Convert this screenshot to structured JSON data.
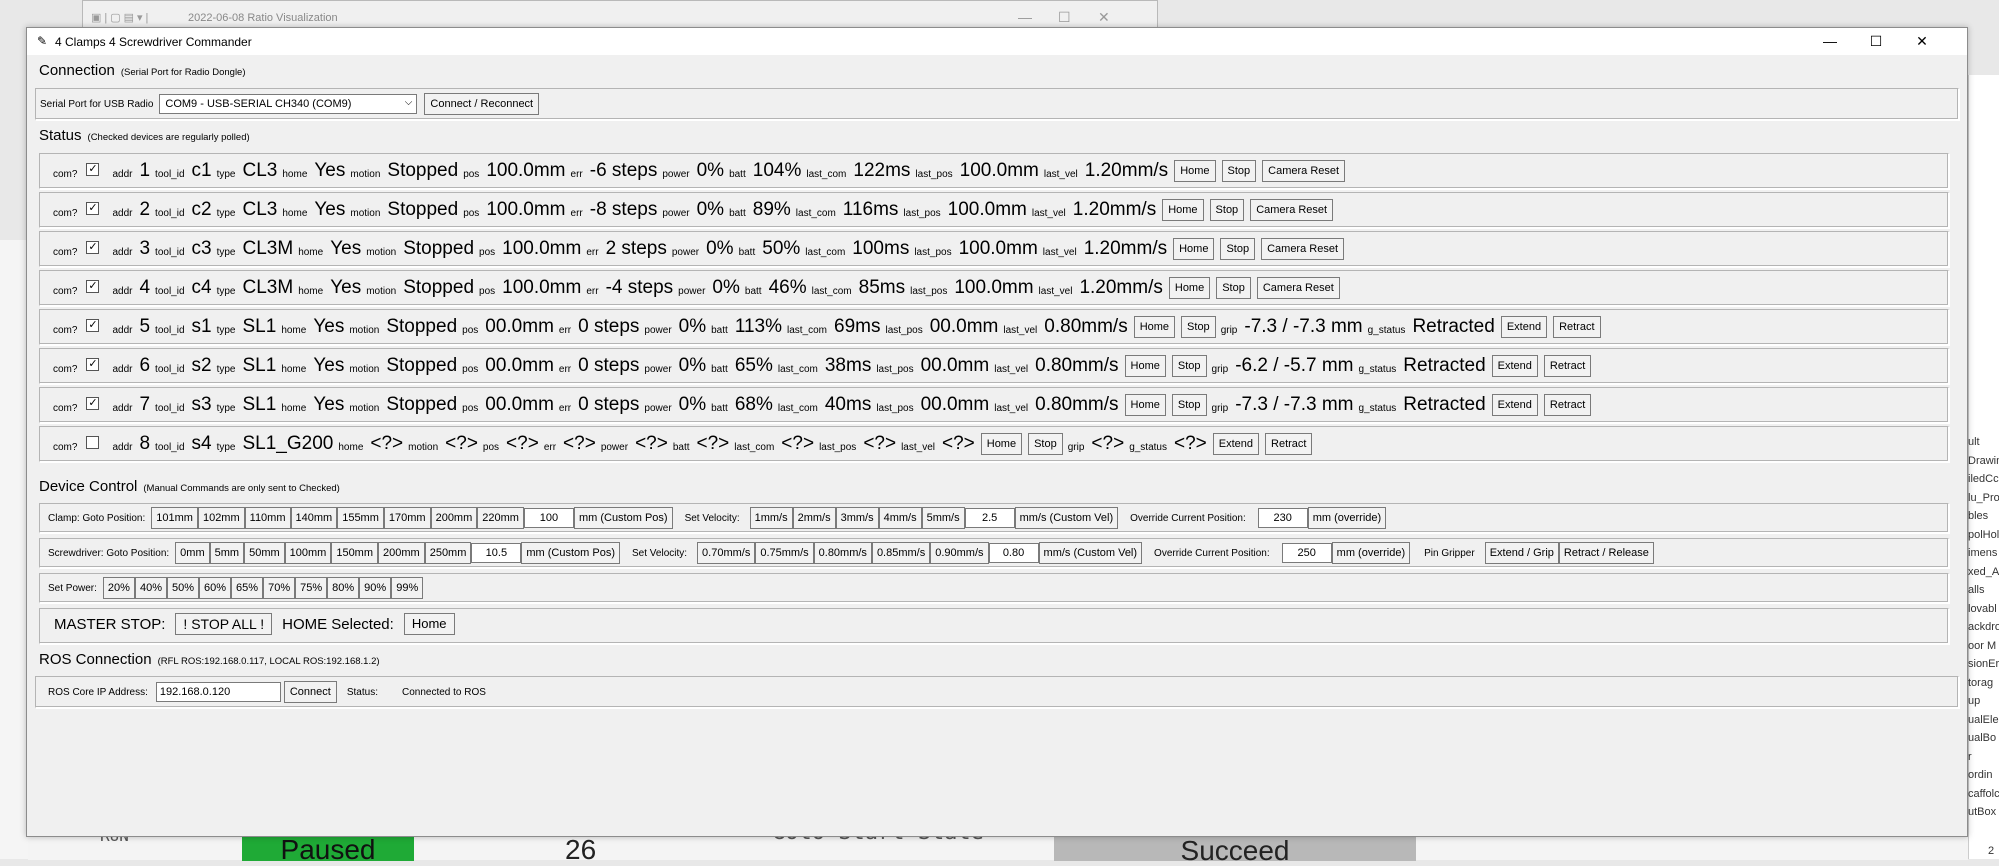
{
  "background": {
    "window_title": "2022-06-08 Ratio Visualization",
    "paused_label": "Paused",
    "counter_value": "26",
    "goto_label": "Goto Start State",
    "succeed_label": "Succeed",
    "run_label": "RUN",
    "right_list": [
      "ult",
      "Drawin",
      "iledCc",
      "lu_Pro",
      "bles",
      "polHol",
      "imens",
      "xed_A",
      "alls",
      "lovabl",
      "ackdro",
      "oor M",
      "sionEr",
      "torag",
      "up",
      "ualEle",
      "ualBo",
      "r",
      "ordin",
      "caffolc",
      "utBox"
    ],
    "right_number": "2"
  },
  "window": {
    "title": "4 Clamps 4 Screwdriver Commander"
  },
  "connection": {
    "heading": "Connection",
    "note": "(Serial Port for Radio Dongle)",
    "port_label": "Serial Port for USB Radio",
    "port_value": "COM9 - USB-SERIAL CH340 (COM9)",
    "connect_button": "Connect / Reconnect"
  },
  "status": {
    "heading": "Status",
    "note": "(Checked devices are regularly polled)",
    "labels": {
      "com": "com?",
      "addr": "addr",
      "tool_id": "tool_id",
      "type": "type",
      "home": "home",
      "motion": "motion",
      "pos": "pos",
      "err": "err",
      "power": "power",
      "batt": "batt",
      "last_com": "last_com",
      "last_pos": "last_pos",
      "last_vel": "last_vel",
      "grip": "grip",
      "g_status": "g_status"
    },
    "buttons": {
      "home": "Home",
      "stop": "Stop",
      "camera_reset": "Camera Reset",
      "extend": "Extend",
      "retract": "Retract"
    },
    "devices": [
      {
        "checked": "✓",
        "addr": "1",
        "tool_id": "c1",
        "type": "CL3",
        "home": "Yes",
        "motion": "Stopped",
        "pos": "100.0mm",
        "err": "-6 steps",
        "power": "0%",
        "batt": "104%",
        "last_com": "122ms",
        "last_pos": "100.0mm",
        "last_vel": "1.20mm/s"
      },
      {
        "checked": "✓",
        "addr": "2",
        "tool_id": "c2",
        "type": "CL3",
        "home": "Yes",
        "motion": "Stopped",
        "pos": "100.0mm",
        "err": "-8 steps",
        "power": "0%",
        "batt": "89%",
        "last_com": "116ms",
        "last_pos": "100.0mm",
        "last_vel": "1.20mm/s"
      },
      {
        "checked": "✓",
        "addr": "3",
        "tool_id": "c3",
        "type": "CL3M",
        "home": "Yes",
        "motion": "Stopped",
        "pos": "100.0mm",
        "err": "2 steps",
        "power": "0%",
        "batt": "50%",
        "last_com": "100ms",
        "last_pos": "100.0mm",
        "last_vel": "1.20mm/s"
      },
      {
        "checked": "✓",
        "addr": "4",
        "tool_id": "c4",
        "type": "CL3M",
        "home": "Yes",
        "motion": "Stopped",
        "pos": "100.0mm",
        "err": "-4 steps",
        "power": "0%",
        "batt": "46%",
        "last_com": "85ms",
        "last_pos": "100.0mm",
        "last_vel": "1.20mm/s"
      },
      {
        "checked": "✓",
        "addr": "5",
        "tool_id": "s1",
        "type": "SL1",
        "home": "Yes",
        "motion": "Stopped",
        "pos": "00.0mm",
        "err": "0 steps",
        "power": "0%",
        "batt": "113%",
        "last_com": "69ms",
        "last_pos": "00.0mm",
        "last_vel": "0.80mm/s",
        "grip": "-7.3 / -7.3 mm",
        "g_status": "Retracted"
      },
      {
        "checked": "✓",
        "addr": "6",
        "tool_id": "s2",
        "type": "SL1",
        "home": "Yes",
        "motion": "Stopped",
        "pos": "00.0mm",
        "err": "0 steps",
        "power": "0%",
        "batt": "65%",
        "last_com": "38ms",
        "last_pos": "00.0mm",
        "last_vel": "0.80mm/s",
        "grip": "-6.2 / -5.7 mm",
        "g_status": "Retracted"
      },
      {
        "checked": "✓",
        "addr": "7",
        "tool_id": "s3",
        "type": "SL1",
        "home": "Yes",
        "motion": "Stopped",
        "pos": "00.0mm",
        "err": "0 steps",
        "power": "0%",
        "batt": "68%",
        "last_com": "40ms",
        "last_pos": "00.0mm",
        "last_vel": "0.80mm/s",
        "grip": "-7.3 / -7.3 mm",
        "g_status": "Retracted"
      },
      {
        "checked": "",
        "addr": "8",
        "tool_id": "s4",
        "type": "SL1_G200",
        "home": "<?>",
        "motion": "<?>",
        "pos": "<?>",
        "err": "<?>",
        "power": "<?>",
        "batt": "<?>",
        "last_com": "<?>",
        "last_pos": "<?>",
        "last_vel": "<?>",
        "grip": "<?>",
        "g_status": "<?>"
      }
    ]
  },
  "device_control": {
    "heading": "Device Control",
    "note": "(Manual Commands are only sent to Checked)",
    "clamp": {
      "goto_label": "Clamp: Goto Position:",
      "positions": [
        "101mm",
        "102mm",
        "110mm",
        "140mm",
        "155mm",
        "170mm",
        "200mm",
        "220mm"
      ],
      "custom_pos_value": "100",
      "custom_pos_button": "mm (Custom Pos)",
      "vel_label": "Set Velocity:",
      "velocities": [
        "1mm/s",
        "2mm/s",
        "3mm/s",
        "4mm/s",
        "5mm/s"
      ],
      "custom_vel_value": "2.5",
      "custom_vel_button": "mm/s (Custom Vel)",
      "override_label": "Override Current Position:",
      "override_value": "230",
      "override_button": "mm (override)"
    },
    "screwdriver": {
      "goto_label": "Screwdriver: Goto Position:",
      "positions": [
        "0mm",
        "5mm",
        "50mm",
        "100mm",
        "150mm",
        "200mm",
        "250mm"
      ],
      "custom_pos_value": "10.5",
      "custom_pos_button": "mm (Custom Pos)",
      "vel_label": "Set Velocity:",
      "velocities": [
        "0.70mm/s",
        "0.75mm/s",
        "0.80mm/s",
        "0.85mm/s",
        "0.90mm/s"
      ],
      "custom_vel_value": "0.80",
      "custom_vel_button": "mm/s (Custom Vel)",
      "override_label": "Override Current Position:",
      "override_value": "250",
      "override_button": "mm (override)",
      "gripper_label": "Pin Gripper",
      "extend_button": "Extend / Grip",
      "retract_button": "Retract / Release"
    },
    "power": {
      "label": "Set Power:",
      "levels": [
        "20%",
        "40%",
        "50%",
        "60%",
        "65%",
        "70%",
        "75%",
        "80%",
        "90%",
        "99%"
      ]
    },
    "master": {
      "stop_label": "MASTER STOP:",
      "stop_button": "! STOP ALL !",
      "home_label": "HOME Selected:",
      "home_button": "Home"
    }
  },
  "ros": {
    "heading": "ROS Connection",
    "note": "(RFL ROS:192.168.0.117, LOCAL ROS:192.168.1.2)",
    "ip_label": "ROS Core IP Address:",
    "ip_value": "192.168.0.120",
    "connect_button": "Connect",
    "status_label": "Status:",
    "status_value": "Connected to ROS"
  }
}
